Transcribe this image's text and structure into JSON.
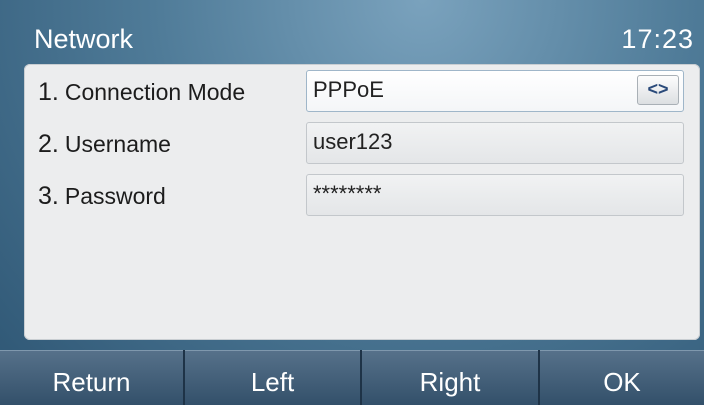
{
  "header": {
    "title": "Network",
    "time": "17:23"
  },
  "settings": [
    {
      "number": "1.",
      "label": "Connection Mode",
      "value": "PPPoE"
    },
    {
      "number": "2.",
      "label": "Username",
      "value": "user123"
    },
    {
      "number": "3.",
      "label": "Password",
      "value": "********"
    }
  ],
  "switch_glyph": "<>",
  "softkeys": {
    "return": "Return",
    "left": "Left",
    "right": "Right",
    "ok": "OK"
  },
  "colors": {
    "panel": "#ecedee",
    "title_bar": "#4f7b98",
    "softkey": "#3c5873"
  }
}
